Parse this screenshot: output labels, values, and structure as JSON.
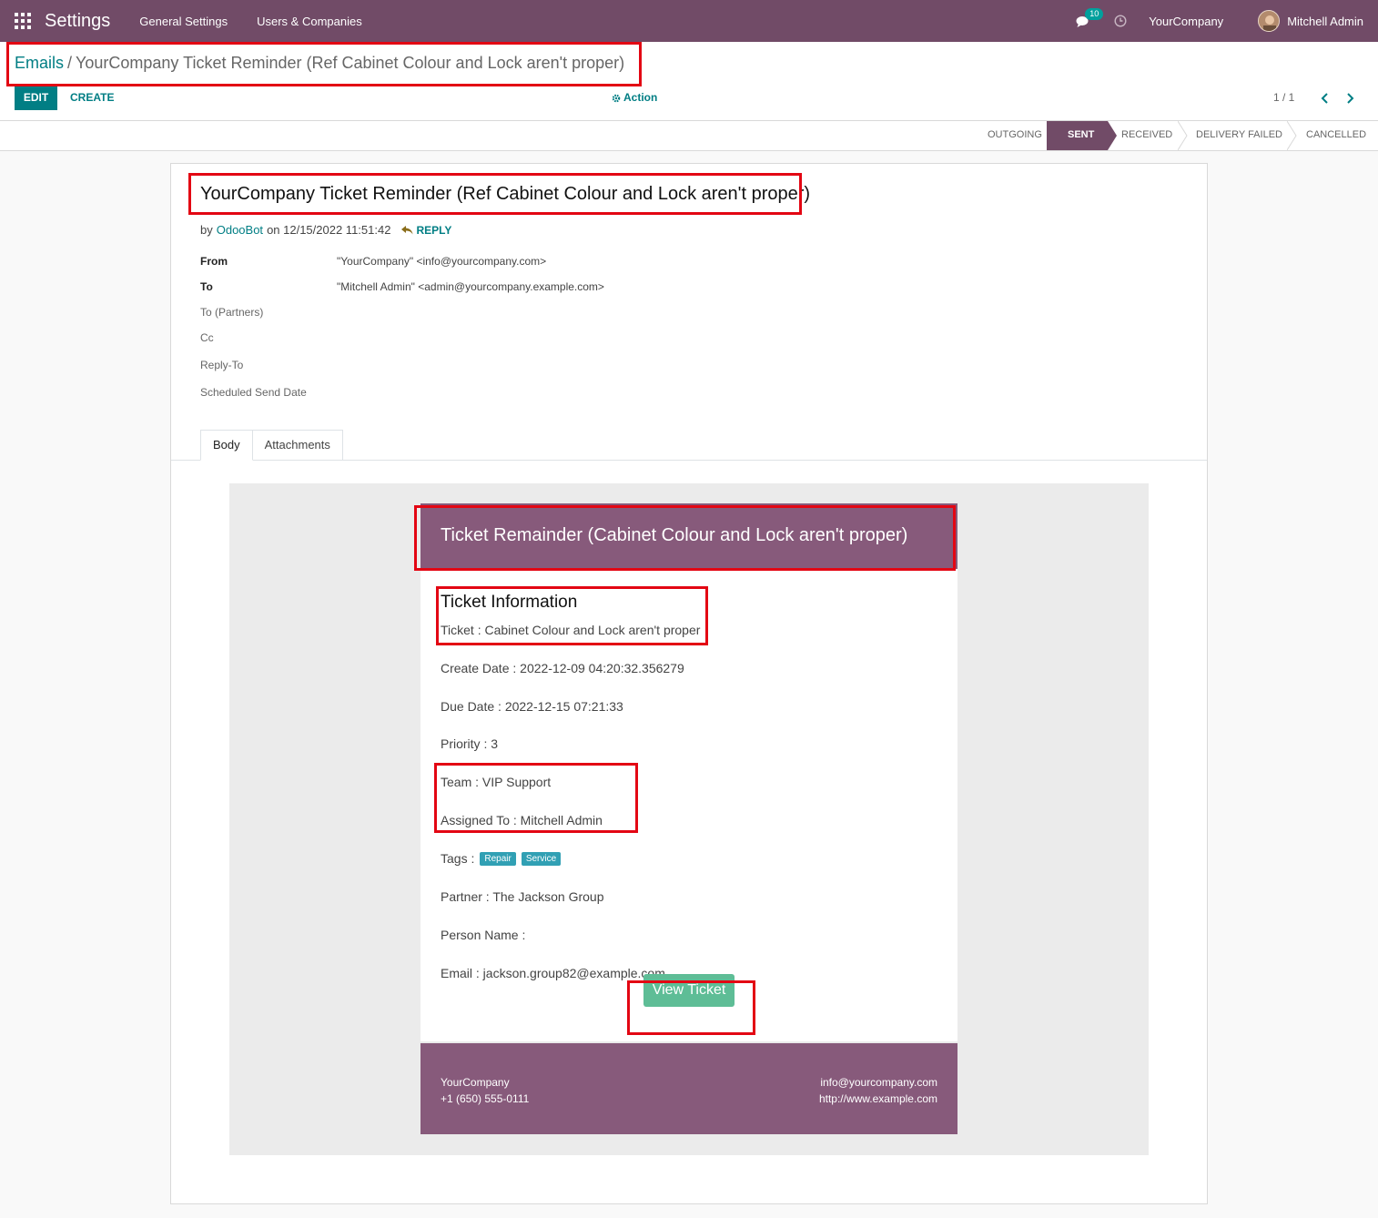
{
  "navbar": {
    "app_name": "Settings",
    "menu": [
      "General Settings",
      "Users & Companies"
    ],
    "chat_count": "10",
    "company": "YourCompany",
    "user": "Mitchell Admin"
  },
  "breadcrumb": {
    "parent": "Emails",
    "separator": "/",
    "current": "YourCompany Ticket Reminder (Ref Cabinet Colour and Lock aren't proper)"
  },
  "toolbar": {
    "edit_label": "EDIT",
    "create_label": "CREATE",
    "action_label": "Action",
    "pager": "1 / 1"
  },
  "statusbar": {
    "stages": [
      "OUTGOING",
      "SENT",
      "RECEIVED",
      "DELIVERY FAILED",
      "CANCELLED"
    ],
    "active": "SENT"
  },
  "message": {
    "subject": "YourCompany Ticket Reminder (Ref Cabinet Colour and Lock aren't proper)",
    "by_prefix": "by",
    "author": "OdooBot",
    "on_text": "on 12/15/2022 11:51:42",
    "reply_label": "REPLY",
    "fields": {
      "from_label": "From",
      "from_value": "\"YourCompany\" <info@yourcompany.com>",
      "to_label": "To",
      "to_value": "\"Mitchell Admin\" <admin@yourcompany.example.com>",
      "to_partners_label": "To (Partners)",
      "cc_label": "Cc",
      "reply_to_label": "Reply-To",
      "scheduled_label": "Scheduled Send Date"
    },
    "tabs": [
      "Body",
      "Attachments"
    ]
  },
  "email_body": {
    "header": "Ticket Remainder (Cabinet Colour and Lock aren't proper)",
    "section_title": "Ticket Information",
    "ticket": "Ticket : Cabinet Colour and Lock aren't proper",
    "create_date": "Create Date : 2022-12-09 04:20:32.356279",
    "due_date": "Due Date : 2022-12-15 07:21:33",
    "priority": "Priority : 3",
    "team": "Team : VIP Support",
    "assigned_to": "Assigned To : Mitchell Admin",
    "tags_label": "Tags :",
    "tags": [
      "Repair",
      "Service"
    ],
    "partner": "Partner : The Jackson Group",
    "person_name": "Person Name :",
    "email": "Email : jackson.group82@example.com",
    "button": "View Ticket",
    "footer": {
      "company": "YourCompany",
      "phone": "+1 (650) 555-0111",
      "email": "info@yourcompany.com",
      "website": "http://www.example.com"
    }
  },
  "colors": {
    "brand": "#714b67",
    "accent": "#017e84",
    "mail_header": "#875a7b",
    "button": "#5ebd96",
    "highlight": "#e30613"
  }
}
